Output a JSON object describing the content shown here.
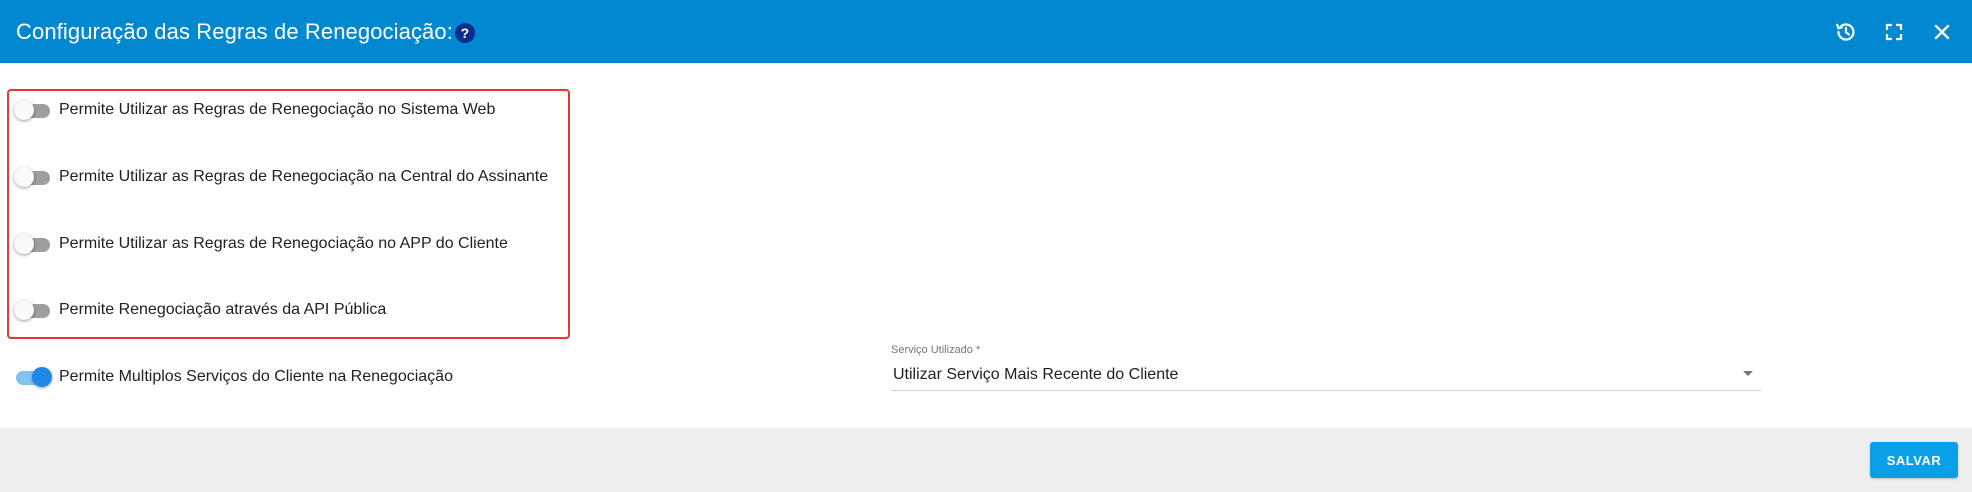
{
  "dialog": {
    "title": "Configuração das Regras de Renegociação:",
    "help_glyph": "?",
    "header_icons": [
      "history-icon",
      "fullscreen-icon",
      "close-icon"
    ]
  },
  "toggles": [
    {
      "label": "Permite Utilizar as Regras de Renegociação no Sistema Web",
      "checked": false
    },
    {
      "label": "Permite Utilizar as Regras de Renegociação na Central do Assinante",
      "checked": false
    },
    {
      "label": "Permite Utilizar as Regras de Renegociação no APP do Cliente",
      "checked": false
    },
    {
      "label": "Permite Renegociação através da API Pública",
      "checked": false
    },
    {
      "label": "Permite Multiplos Serviços do Cliente na Renegociação",
      "checked": true
    }
  ],
  "service_select": {
    "label": "Serviço Utilizado *",
    "value": "Utilizar Serviço Mais Recente do Cliente"
  },
  "footer": {
    "save_label": "SALVAR"
  },
  "colors": {
    "header": "#0288d1",
    "highlight_border": "#e53935",
    "toggle_on": "#1e88e5",
    "save_button": "#0aa0e8"
  }
}
